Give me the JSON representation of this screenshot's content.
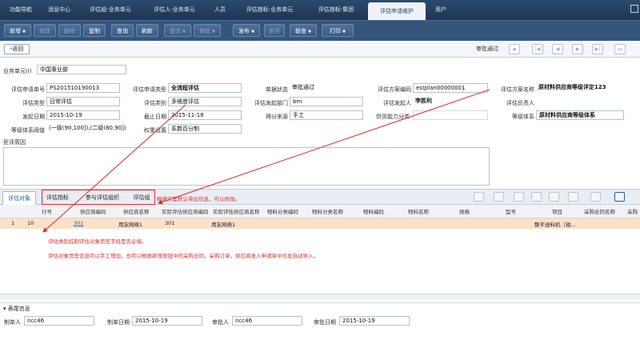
{
  "nav": {
    "tabs": [
      "功能导航",
      "消息中心",
      "评估组-业务单元",
      "评估人-业务单元",
      "人员",
      "评估指标-业务单元",
      "评估指标-集团",
      "评估申请维护",
      "用户"
    ],
    "active_index": 7
  },
  "toolbar": {
    "add": "新增",
    "edit": "修改",
    "delete": "删除",
    "copy": "复制",
    "query": "查询",
    "refresh": "刷新",
    "submit": "提交",
    "approve": "审批",
    "publish": "发布",
    "reject": "拒评",
    "assoc": "联查",
    "print": "打印"
  },
  "subbar": {
    "back": "返回",
    "status": "审批通过"
  },
  "org": {
    "label": "业务单元",
    "required_mark": "(I)",
    "value": "中国事业部"
  },
  "form": {
    "apply_no_label": "评估申请单号",
    "apply_no": "PS201510190013",
    "apply_type_label": "评估申请类型",
    "apply_type": "全流程评估",
    "bill_status_label": "单据状态",
    "bill_status": "审批通过",
    "plan_code_label": "评估方案编码",
    "plan_code": "estplan00000001",
    "plan_name_label": "评估方案名称",
    "plan_name": "原材料供应商等级评定123",
    "eval_type_label": "评估类型",
    "eval_type": "日常评估",
    "eval_category_label": "评估类别",
    "eval_category": "多维度评估",
    "dept_label": "评估发起部门",
    "dept": "bm",
    "initiator_label": "评估发起人",
    "initiator": "李胜利",
    "owner_label": "评估负责人",
    "owner": "",
    "start_date_label": "发起日期",
    "start_date": "2015-10-19",
    "end_date_label": "截止日期",
    "end_date": "2015-11-18",
    "score_source_label": "得分来源",
    "score_source": "手工",
    "supply_class_label": "供货能力分类",
    "supply_class": "",
    "grade_system_label": "等级体系",
    "grade_system": "原材料供应商等级体系",
    "grade_threshold_label": "等级体系阈值",
    "grade_threshold": "(一级(90,100]),(二级(80,90]),",
    "weight_label": "权重设置",
    "weight": "系数百分制",
    "reject_reason_label": "拒评原因"
  },
  "tabs": [
    "评估对象",
    "评估指标",
    "参与评估组织",
    "评估组"
  ],
  "tab_hint": "根据方案默认带出信息，可以修改。",
  "grid": {
    "headers": [
      "行号",
      "供应商编码",
      "供应商名称",
      "实际评估供应商编码",
      "实际评估供应商名称",
      "物料分类编码",
      "物料分类名称",
      "物料编码",
      "物料名称",
      "规格",
      "型号",
      "项目",
      "采购合同名称",
      "采购"
    ],
    "rows": [
      {
        "idx": "1",
        "line": "10",
        "sup_code": "301",
        "sup_name": "用友网络1",
        "act_code": "301",
        "act_name": "用友网络1",
        "project": "整平送料机（钳..."
      }
    ]
  },
  "notes": [
    "评估类别控制评估对象页签字段是否必填。",
    "评估对象页签信息可以手工增加，也可以根据新增按钮中的采购合同，采购订单，供应商准入申请单中信息自动导入。"
  ],
  "footer": {
    "section": "表尾信息",
    "creator_label": "制单人",
    "creator": "ncc46",
    "create_date_label": "制单日期",
    "create_date": "2015-10-19",
    "approver_label": "审批人",
    "approver": "ncc46",
    "approve_date_label": "审批日期",
    "approve_date": "2015-10-19"
  },
  "colors": {
    "nav": "#1d3555",
    "toolbar": "#36557b",
    "annot": "#e32626",
    "row_selected": "#fbe1c7"
  }
}
